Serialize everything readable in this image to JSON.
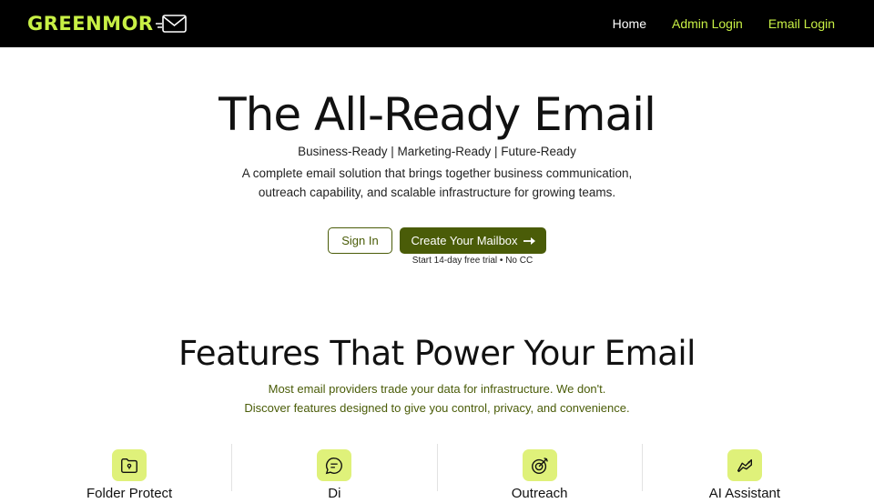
{
  "nav": {
    "logo_text": "GREENMOR",
    "links": [
      {
        "label": "Home"
      },
      {
        "label": "Admin Login"
      },
      {
        "label": "Email Login"
      }
    ]
  },
  "hero": {
    "title": "The All-Ready Email",
    "tagline": "Business-Ready | Marketing-Ready | Future-Ready",
    "description": "A complete email solution that brings together business communication, outreach capability, and scalable infrastructure for growing teams.",
    "signin_label": "Sign In",
    "create_label": "Create Your Mailbox",
    "trial_note": "Start 14-day free trial • No CC"
  },
  "features": {
    "title": "Features That Power Your Email",
    "subtitle_line1": "Most email providers trade your data for infrastructure. We don't.",
    "subtitle_line2": "Discover features designed to give you control, privacy, and convenience.",
    "cards": [
      {
        "icon": "folder-lock-icon",
        "label": "Folder Protect"
      },
      {
        "icon": "chat-bubble-icon",
        "label": "Di"
      },
      {
        "icon": "target-icon",
        "label": "Outreach"
      },
      {
        "icon": "ai-assist-icon",
        "label": "AI Assistant"
      }
    ]
  },
  "colors": {
    "accent": "#c8f045",
    "brand_dark": "#4a5c08",
    "icon_bg": "#dff17a"
  }
}
